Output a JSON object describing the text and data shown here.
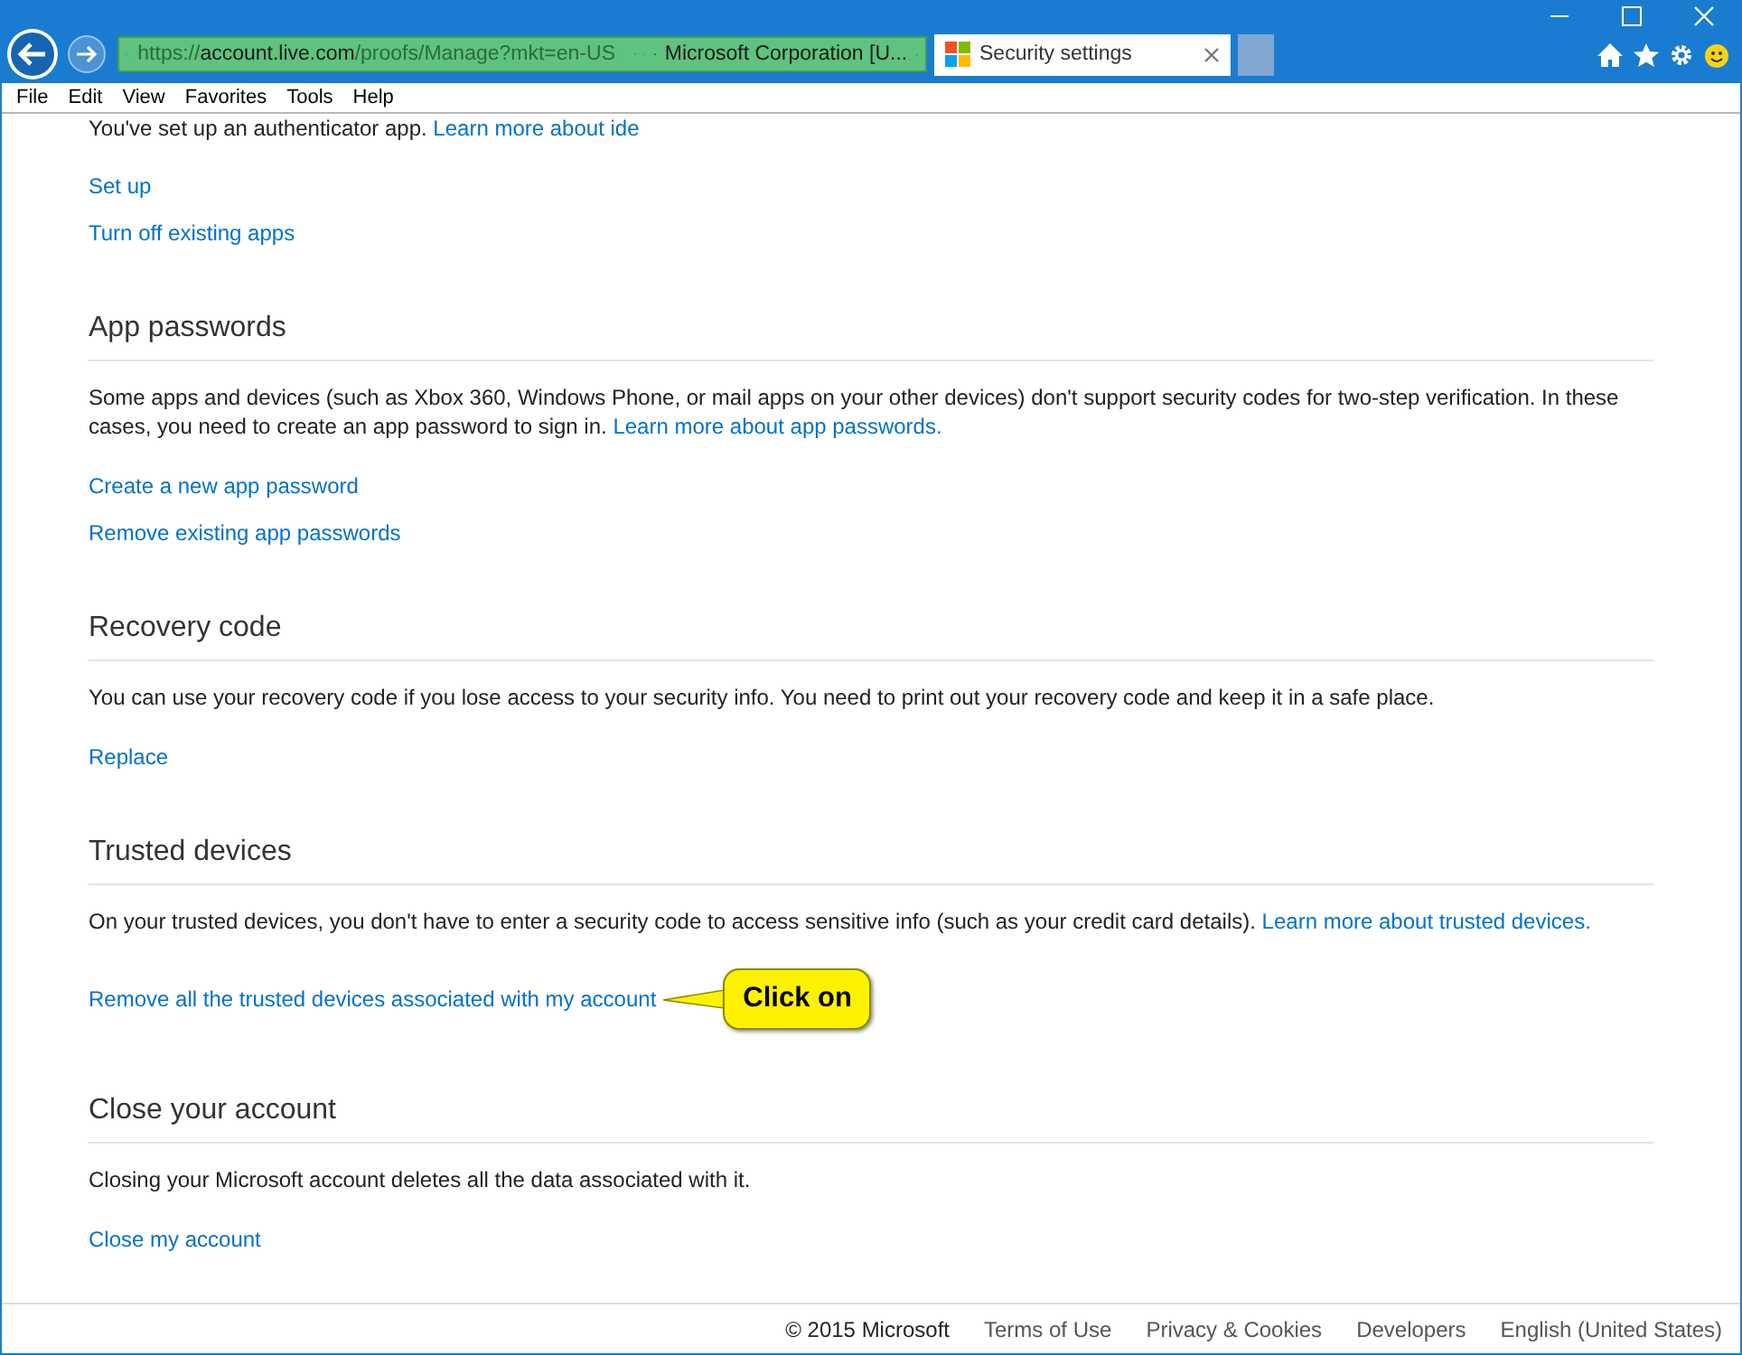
{
  "browser": {
    "url": {
      "scheme": "https://",
      "host": "account.live.com",
      "path": "/proofs/Manage?mkt=en-US"
    },
    "identity": "Microsoft Corporation [U...",
    "tabs": [
      {
        "title": "Security settings",
        "selected": true
      }
    ],
    "menu": [
      "File",
      "Edit",
      "View",
      "Favorites",
      "Tools",
      "Help"
    ]
  },
  "intro": {
    "text": "You've set up an authenticator app.",
    "link": "Learn more about ide"
  },
  "intro_links": [
    "Set up",
    "Turn off existing apps"
  ],
  "sections": [
    {
      "heading": "App passwords",
      "text": "Some apps and devices (such as Xbox 360, Windows Phone, or mail apps on your other devices) don't support security codes for two-step verification. In these cases, you need to create an app password to sign in.",
      "text_link": "Learn more about app passwords.",
      "links": [
        "Create a new app password",
        "Remove existing app passwords"
      ]
    },
    {
      "heading": "Recovery code",
      "text": "You can use your recovery code if you lose access to your security info. You need to print out your recovery code and keep it in a safe place.",
      "links": [
        "Replace"
      ]
    },
    {
      "heading": "Trusted devices",
      "text": "On your trusted devices, you don't have to enter a security code to access sensitive info (such as your credit card details).",
      "text_link": "Learn more about trusted devices.",
      "links": [
        "Remove all the trusted devices associated with my account"
      ],
      "callout": "Click on"
    },
    {
      "heading": "Close your account",
      "text": "Closing your Microsoft account deletes all the data associated with it.",
      "links": [
        "Close my account"
      ]
    }
  ],
  "footer": {
    "copyright": "© 2015 Microsoft",
    "links": [
      "Terms of Use",
      "Privacy & Cookies",
      "Developers",
      "English (United States)"
    ]
  }
}
